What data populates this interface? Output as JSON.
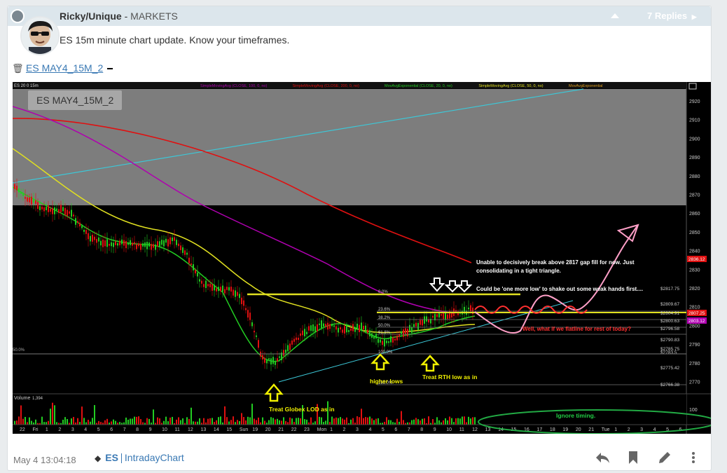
{
  "post": {
    "author": "Ricky/Unique",
    "category_sep": " - ",
    "category": "MARKETS",
    "replies": "7 Replies",
    "text": "ES 15m minute chart update. Know your timeframes.",
    "attachment": "ES MAY4_15M_2",
    "date": "May 4 13:04:18",
    "tags": [
      "ES",
      "IntradayChart"
    ]
  },
  "chart": {
    "label": "ES MAY4_15M_2",
    "header_prefix": "ES 20 0 15m",
    "header_items": [
      "SimpleMovingAvg (CLOSE, 100, 0, no)",
      "SimpleMovingAvg (CLOSE, 200, 0, no)",
      "MovAvgExponential (CLOSE, 20, 0, no)",
      "SimpleMovingAvg (CLOSE, 50, 0, no)",
      "MovAvgExponential"
    ],
    "price_ticks": [
      "2920",
      "2910",
      "2900",
      "2890",
      "2880",
      "2870",
      "2860",
      "2850",
      "2840",
      "2830",
      "2820",
      "2810",
      "2800",
      "2790",
      "2780",
      "2770"
    ],
    "fib_labels": [
      "0.0%",
      "23.6%",
      "38.2%",
      "50.0%",
      "61.8%",
      "100.0%",
      "150.0%"
    ],
    "fib_prices": [
      "$2817.75",
      "$2809.67",
      "$2804.91",
      "$2800.63",
      "$2796.58",
      "$2790.83",
      "$2785.75",
      "$2783.5",
      "$2775.42",
      "$2766.38"
    ],
    "price_badges": [
      "2836.12",
      "2807.25",
      "2803.12"
    ],
    "x_labels": [
      "22",
      "Fri",
      "1",
      "2",
      "3",
      "4",
      "5",
      "6",
      "7",
      "8",
      "9",
      "10",
      "11",
      "12",
      "13",
      "14",
      "15",
      "Sun",
      "19",
      "20",
      "21",
      "22",
      "23",
      "Mon",
      "1",
      "2",
      "3",
      "4",
      "5",
      "6",
      "7",
      "8",
      "9",
      "10",
      "11",
      "12",
      "13",
      "14",
      "15",
      "16",
      "17",
      "18",
      "19",
      "20",
      "21",
      "Tue",
      "1",
      "2",
      "3",
      "4",
      "5",
      "6"
    ],
    "volume_label": "Volume",
    "volume_value": "1,394",
    "volume_tick": "100",
    "left_label": "50.0%",
    "annotations": {
      "text1": "Unable to decisively break above 2817 gap fill for now. Just",
      "text2": "consolidating in a tight triangle.",
      "text3": "Could be 'one more low' to shake out some weak hands first....",
      "text4": "Well, what if we flatline for rest of today?",
      "higher_lows": "higher lows",
      "treat_rth": "Treat RTH low as in",
      "treat_globex": "Treat Globex LOD as in",
      "ignore": "Ignore timing."
    }
  },
  "colors": {
    "accent": "#3a79b4",
    "header_bg": "#dce6ec",
    "sma100": "#b000b0",
    "sma200": "#e01010",
    "ema20": "#22cc22",
    "sma50": "#e0e020",
    "trend": "#3cc8d8"
  },
  "icons": [
    "user-online-icon",
    "collapse-icon",
    "chevron-right-icon",
    "trash-icon",
    "tag-icon",
    "reply-icon",
    "bookmark-icon",
    "edit-icon",
    "more-icon"
  ]
}
